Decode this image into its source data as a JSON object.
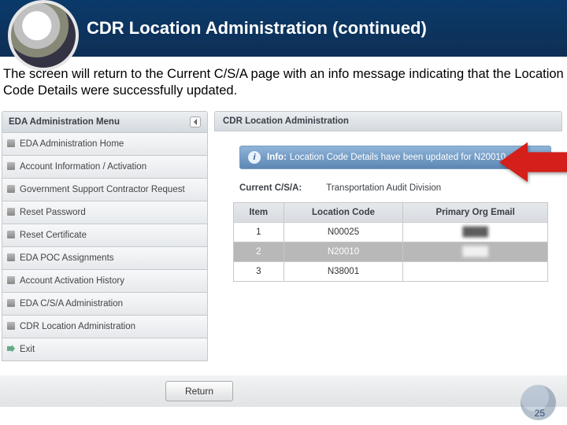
{
  "title": "CDR Location Administration (continued)",
  "caption": "The screen will return to the Current C/S/A page with an info message indicating that the Location Code Details were successfully updated.",
  "sidebar": {
    "heading": "EDA Administration Menu",
    "items": [
      "EDA Administration Home",
      "Account Information / Activation",
      "Government Support Contractor Request",
      "Reset Password",
      "Reset Certificate",
      "EDA POC Assignments",
      "Account Activation History",
      "EDA C/S/A Administration",
      "CDR Location Administration",
      "Exit"
    ]
  },
  "mainHeading": "CDR Location Administration",
  "info": {
    "prefix": "Info:",
    "text": "Location Code Details have been updated for N20010"
  },
  "csa": {
    "label": "Current C/S/A:",
    "value": "Transportation Audit Division"
  },
  "table": {
    "headers": [
      "Item",
      "Location Code",
      "Primary Org Email"
    ],
    "rows": [
      {
        "n": "1",
        "code": "N00025",
        "email": "████"
      },
      {
        "n": "2",
        "code": "N20010",
        "email": "████"
      },
      {
        "n": "3",
        "code": "N38001",
        "email": ""
      }
    ],
    "selectedIndex": 1
  },
  "returnLabel": "Return",
  "pageNumber": "25"
}
